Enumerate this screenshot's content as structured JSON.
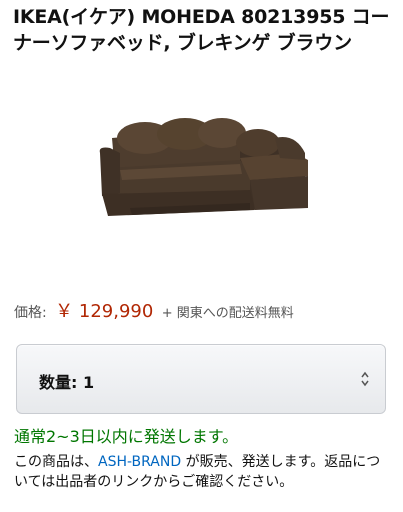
{
  "product": {
    "title": "IKEA(イケア) MOHEDA 80213955 コーナーソファベッド, ブレキンゲ ブラウン",
    "image_alt": "sofa-bed-image"
  },
  "price": {
    "label": "価格:",
    "value": "￥ 129,990",
    "shipping": "+ 関東への配送料無料"
  },
  "quantity": {
    "label": "数量: 1"
  },
  "availability": {
    "status": "通常2~3日以内に発送します。",
    "line_prefix": "この商品は、",
    "seller": "ASH-BRAND",
    "line_suffix": " が販売、発送します。返品については出品者のリンクからご確認ください。"
  },
  "colors": {
    "price": "#b12704",
    "availability": "#007600",
    "link": "#0066c0",
    "sofa": "#4a3a2c"
  }
}
